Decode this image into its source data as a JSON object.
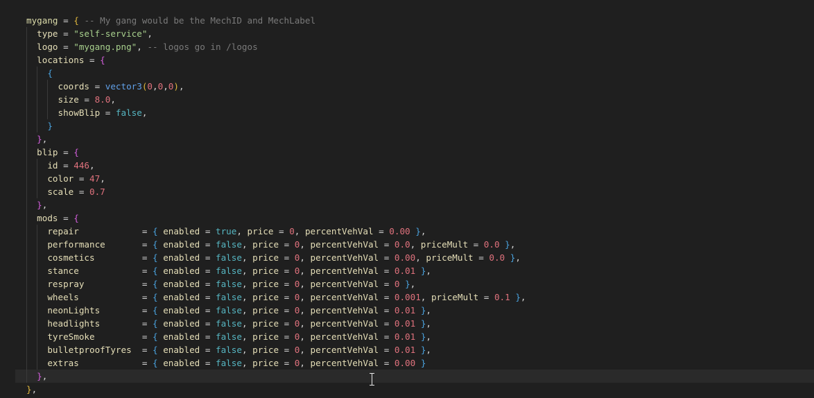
{
  "editor": {
    "active_line": 27,
    "colors": {
      "background": "#1f1f1f",
      "active_line": "#2a2a2a",
      "string": "#a8d08d",
      "number": "#e0727d",
      "boolean": "#56b6c2",
      "comment": "#7a7a7a",
      "function": "#61a0e8"
    },
    "lines": [
      [
        [
          "id",
          "mygang"
        ],
        [
          "op",
          " = "
        ],
        [
          "b1",
          "{"
        ],
        [
          "op",
          " "
        ],
        [
          "cmt",
          "-- My gang would be the MechID and MechLabel"
        ]
      ],
      [
        [
          "op",
          "  "
        ],
        [
          "key",
          "type"
        ],
        [
          "op",
          " = "
        ],
        [
          "str",
          "\"self-service\""
        ],
        [
          "op",
          ","
        ]
      ],
      [
        [
          "op",
          "  "
        ],
        [
          "key",
          "logo"
        ],
        [
          "op",
          " = "
        ],
        [
          "str",
          "\"mygang.png\""
        ],
        [
          "op",
          ", "
        ],
        [
          "cmt",
          "-- logos go in /logos"
        ]
      ],
      [
        [
          "op",
          "  "
        ],
        [
          "key",
          "locations"
        ],
        [
          "op",
          " = "
        ],
        [
          "b2",
          "{"
        ]
      ],
      [
        [
          "op",
          "    "
        ],
        [
          "b3",
          "{"
        ]
      ],
      [
        [
          "op",
          "      "
        ],
        [
          "key",
          "coords"
        ],
        [
          "op",
          " = "
        ],
        [
          "fn",
          "vector3"
        ],
        [
          "b1",
          "("
        ],
        [
          "num",
          "0"
        ],
        [
          "op",
          ","
        ],
        [
          "num",
          "0"
        ],
        [
          "op",
          ","
        ],
        [
          "num",
          "0"
        ],
        [
          "b1",
          ")"
        ],
        [
          "op",
          ","
        ]
      ],
      [
        [
          "op",
          "      "
        ],
        [
          "key",
          "size"
        ],
        [
          "op",
          " = "
        ],
        [
          "num",
          "8.0"
        ],
        [
          "op",
          ","
        ]
      ],
      [
        [
          "op",
          "      "
        ],
        [
          "key",
          "showBlip"
        ],
        [
          "op",
          " = "
        ],
        [
          "bool",
          "false"
        ],
        [
          "op",
          ","
        ]
      ],
      [
        [
          "op",
          "    "
        ],
        [
          "b3",
          "}"
        ]
      ],
      [
        [
          "op",
          "  "
        ],
        [
          "b2",
          "}"
        ],
        [
          "op",
          ","
        ]
      ],
      [
        [
          "op",
          "  "
        ],
        [
          "key",
          "blip"
        ],
        [
          "op",
          " = "
        ],
        [
          "b2",
          "{"
        ]
      ],
      [
        [
          "op",
          "    "
        ],
        [
          "key",
          "id"
        ],
        [
          "op",
          " = "
        ],
        [
          "num",
          "446"
        ],
        [
          "op",
          ","
        ]
      ],
      [
        [
          "op",
          "    "
        ],
        [
          "key",
          "color"
        ],
        [
          "op",
          " = "
        ],
        [
          "num",
          "47"
        ],
        [
          "op",
          ","
        ]
      ],
      [
        [
          "op",
          "    "
        ],
        [
          "key",
          "scale"
        ],
        [
          "op",
          " = "
        ],
        [
          "num",
          "0.7"
        ]
      ],
      [
        [
          "op",
          "  "
        ],
        [
          "b2",
          "}"
        ],
        [
          "op",
          ","
        ]
      ],
      [
        [
          "op",
          "  "
        ],
        [
          "key",
          "mods"
        ],
        [
          "op",
          " = "
        ],
        [
          "b2",
          "{"
        ]
      ],
      [
        [
          "op",
          "    "
        ],
        [
          "key",
          "repair           "
        ],
        [
          "op",
          " = "
        ],
        [
          "b3",
          "{"
        ],
        [
          "op",
          " "
        ],
        [
          "key",
          "enabled"
        ],
        [
          "op",
          " = "
        ],
        [
          "bool",
          "true"
        ],
        [
          "op",
          ", "
        ],
        [
          "key",
          "price"
        ],
        [
          "op",
          " = "
        ],
        [
          "num",
          "0"
        ],
        [
          "op",
          ", "
        ],
        [
          "key",
          "percentVehVal"
        ],
        [
          "op",
          " = "
        ],
        [
          "num",
          "0.00"
        ],
        [
          "op",
          " "
        ],
        [
          "b3",
          "}"
        ],
        [
          "op",
          ","
        ]
      ],
      [
        [
          "op",
          "    "
        ],
        [
          "key",
          "performance      "
        ],
        [
          "op",
          " = "
        ],
        [
          "b3",
          "{"
        ],
        [
          "op",
          " "
        ],
        [
          "key",
          "enabled"
        ],
        [
          "op",
          " = "
        ],
        [
          "bool",
          "false"
        ],
        [
          "op",
          ", "
        ],
        [
          "key",
          "price"
        ],
        [
          "op",
          " = "
        ],
        [
          "num",
          "0"
        ],
        [
          "op",
          ", "
        ],
        [
          "key",
          "percentVehVal"
        ],
        [
          "op",
          " = "
        ],
        [
          "num",
          "0.0"
        ],
        [
          "op",
          ", "
        ],
        [
          "key",
          "priceMult"
        ],
        [
          "op",
          " = "
        ],
        [
          "num",
          "0.0"
        ],
        [
          "op",
          " "
        ],
        [
          "b3",
          "}"
        ],
        [
          "op",
          ","
        ]
      ],
      [
        [
          "op",
          "    "
        ],
        [
          "key",
          "cosmetics        "
        ],
        [
          "op",
          " = "
        ],
        [
          "b3",
          "{"
        ],
        [
          "op",
          " "
        ],
        [
          "key",
          "enabled"
        ],
        [
          "op",
          " = "
        ],
        [
          "bool",
          "false"
        ],
        [
          "op",
          ", "
        ],
        [
          "key",
          "price"
        ],
        [
          "op",
          " = "
        ],
        [
          "num",
          "0"
        ],
        [
          "op",
          ", "
        ],
        [
          "key",
          "percentVehVal"
        ],
        [
          "op",
          " = "
        ],
        [
          "num",
          "0.00"
        ],
        [
          "op",
          ", "
        ],
        [
          "key",
          "priceMult"
        ],
        [
          "op",
          " = "
        ],
        [
          "num",
          "0.0"
        ],
        [
          "op",
          " "
        ],
        [
          "b3",
          "}"
        ],
        [
          "op",
          ","
        ]
      ],
      [
        [
          "op",
          "    "
        ],
        [
          "key",
          "stance           "
        ],
        [
          "op",
          " = "
        ],
        [
          "b3",
          "{"
        ],
        [
          "op",
          " "
        ],
        [
          "key",
          "enabled"
        ],
        [
          "op",
          " = "
        ],
        [
          "bool",
          "false"
        ],
        [
          "op",
          ", "
        ],
        [
          "key",
          "price"
        ],
        [
          "op",
          " = "
        ],
        [
          "num",
          "0"
        ],
        [
          "op",
          ", "
        ],
        [
          "key",
          "percentVehVal"
        ],
        [
          "op",
          " = "
        ],
        [
          "num",
          "0.01"
        ],
        [
          "op",
          " "
        ],
        [
          "b3",
          "}"
        ],
        [
          "op",
          ","
        ]
      ],
      [
        [
          "op",
          "    "
        ],
        [
          "key",
          "respray          "
        ],
        [
          "op",
          " = "
        ],
        [
          "b3",
          "{"
        ],
        [
          "op",
          " "
        ],
        [
          "key",
          "enabled"
        ],
        [
          "op",
          " = "
        ],
        [
          "bool",
          "false"
        ],
        [
          "op",
          ", "
        ],
        [
          "key",
          "price"
        ],
        [
          "op",
          " = "
        ],
        [
          "num",
          "0"
        ],
        [
          "op",
          ", "
        ],
        [
          "key",
          "percentVehVal"
        ],
        [
          "op",
          " = "
        ],
        [
          "num",
          "0"
        ],
        [
          "op",
          " "
        ],
        [
          "b3",
          "}"
        ],
        [
          "op",
          ","
        ]
      ],
      [
        [
          "op",
          "    "
        ],
        [
          "key",
          "wheels           "
        ],
        [
          "op",
          " = "
        ],
        [
          "b3",
          "{"
        ],
        [
          "op",
          " "
        ],
        [
          "key",
          "enabled"
        ],
        [
          "op",
          " = "
        ],
        [
          "bool",
          "false"
        ],
        [
          "op",
          ", "
        ],
        [
          "key",
          "price"
        ],
        [
          "op",
          " = "
        ],
        [
          "num",
          "0"
        ],
        [
          "op",
          ", "
        ],
        [
          "key",
          "percentVehVal"
        ],
        [
          "op",
          " = "
        ],
        [
          "num",
          "0.001"
        ],
        [
          "op",
          ", "
        ],
        [
          "key",
          "priceMult"
        ],
        [
          "op",
          " = "
        ],
        [
          "num",
          "0.1"
        ],
        [
          "op",
          " "
        ],
        [
          "b3",
          "}"
        ],
        [
          "op",
          ","
        ]
      ],
      [
        [
          "op",
          "    "
        ],
        [
          "key",
          "neonLights       "
        ],
        [
          "op",
          " = "
        ],
        [
          "b3",
          "{"
        ],
        [
          "op",
          " "
        ],
        [
          "key",
          "enabled"
        ],
        [
          "op",
          " = "
        ],
        [
          "bool",
          "false"
        ],
        [
          "op",
          ", "
        ],
        [
          "key",
          "price"
        ],
        [
          "op",
          " = "
        ],
        [
          "num",
          "0"
        ],
        [
          "op",
          ", "
        ],
        [
          "key",
          "percentVehVal"
        ],
        [
          "op",
          " = "
        ],
        [
          "num",
          "0.01"
        ],
        [
          "op",
          " "
        ],
        [
          "b3",
          "}"
        ],
        [
          "op",
          ","
        ]
      ],
      [
        [
          "op",
          "    "
        ],
        [
          "key",
          "headlights       "
        ],
        [
          "op",
          " = "
        ],
        [
          "b3",
          "{"
        ],
        [
          "op",
          " "
        ],
        [
          "key",
          "enabled"
        ],
        [
          "op",
          " = "
        ],
        [
          "bool",
          "false"
        ],
        [
          "op",
          ", "
        ],
        [
          "key",
          "price"
        ],
        [
          "op",
          " = "
        ],
        [
          "num",
          "0"
        ],
        [
          "op",
          ", "
        ],
        [
          "key",
          "percentVehVal"
        ],
        [
          "op",
          " = "
        ],
        [
          "num",
          "0.01"
        ],
        [
          "op",
          " "
        ],
        [
          "b3",
          "}"
        ],
        [
          "op",
          ","
        ]
      ],
      [
        [
          "op",
          "    "
        ],
        [
          "key",
          "tyreSmoke        "
        ],
        [
          "op",
          " = "
        ],
        [
          "b3",
          "{"
        ],
        [
          "op",
          " "
        ],
        [
          "key",
          "enabled"
        ],
        [
          "op",
          " = "
        ],
        [
          "bool",
          "false"
        ],
        [
          "op",
          ", "
        ],
        [
          "key",
          "price"
        ],
        [
          "op",
          " = "
        ],
        [
          "num",
          "0"
        ],
        [
          "op",
          ", "
        ],
        [
          "key",
          "percentVehVal"
        ],
        [
          "op",
          " = "
        ],
        [
          "num",
          "0.01"
        ],
        [
          "op",
          " "
        ],
        [
          "b3",
          "}"
        ],
        [
          "op",
          ","
        ]
      ],
      [
        [
          "op",
          "    "
        ],
        [
          "key",
          "bulletproofTyres "
        ],
        [
          "op",
          " = "
        ],
        [
          "b3",
          "{"
        ],
        [
          "op",
          " "
        ],
        [
          "key",
          "enabled"
        ],
        [
          "op",
          " = "
        ],
        [
          "bool",
          "false"
        ],
        [
          "op",
          ", "
        ],
        [
          "key",
          "price"
        ],
        [
          "op",
          " = "
        ],
        [
          "num",
          "0"
        ],
        [
          "op",
          ", "
        ],
        [
          "key",
          "percentVehVal"
        ],
        [
          "op",
          " = "
        ],
        [
          "num",
          "0.01"
        ],
        [
          "op",
          " "
        ],
        [
          "b3",
          "}"
        ],
        [
          "op",
          ","
        ]
      ],
      [
        [
          "op",
          "    "
        ],
        [
          "key",
          "extras           "
        ],
        [
          "op",
          " = "
        ],
        [
          "b3",
          "{"
        ],
        [
          "op",
          " "
        ],
        [
          "key",
          "enabled"
        ],
        [
          "op",
          " = "
        ],
        [
          "bool",
          "false"
        ],
        [
          "op",
          ", "
        ],
        [
          "key",
          "price"
        ],
        [
          "op",
          " = "
        ],
        [
          "num",
          "0"
        ],
        [
          "op",
          ", "
        ],
        [
          "key",
          "percentVehVal"
        ],
        [
          "op",
          " = "
        ],
        [
          "num",
          "0.00"
        ],
        [
          "op",
          " "
        ],
        [
          "b3",
          "}"
        ]
      ],
      [
        [
          "op",
          "  "
        ],
        [
          "b2",
          "}"
        ],
        [
          "op",
          ","
        ]
      ],
      [
        [
          "b1",
          "}"
        ],
        [
          "op",
          ","
        ]
      ]
    ]
  }
}
